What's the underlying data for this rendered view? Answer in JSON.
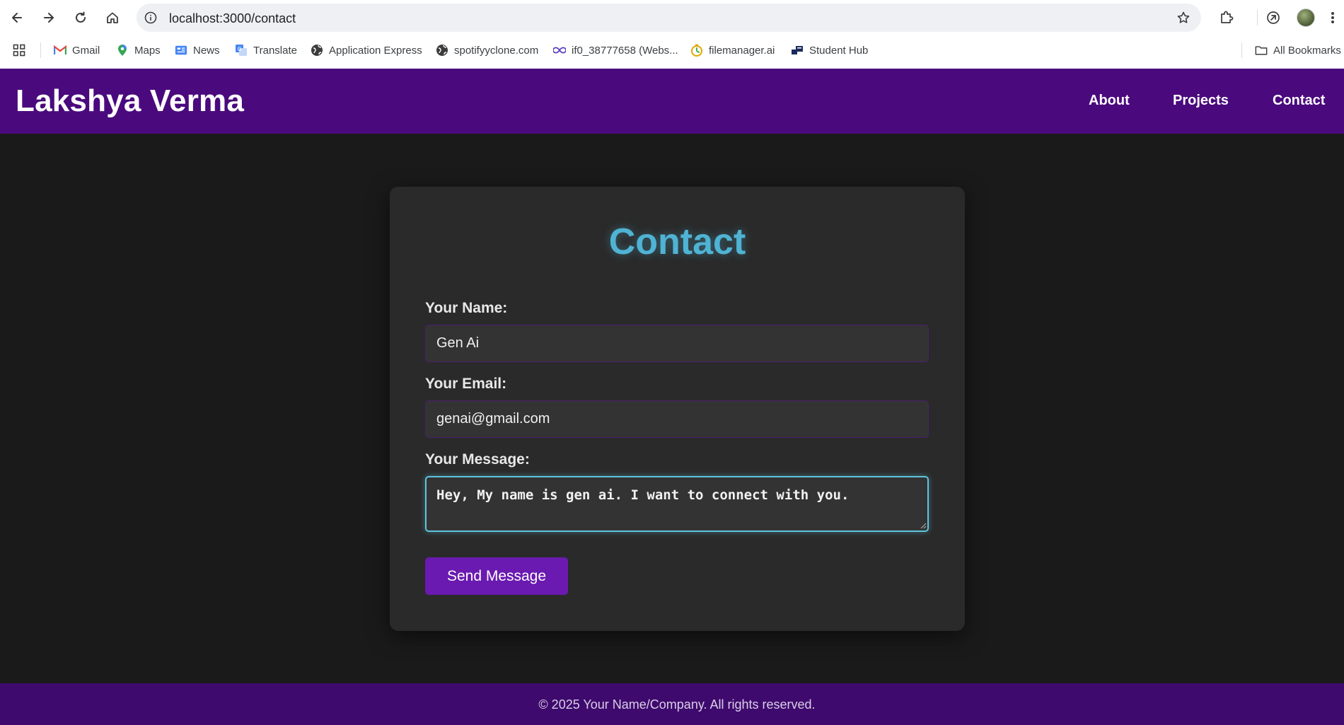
{
  "browser": {
    "url": "localhost:3000/contact",
    "bookmarks": [
      {
        "label": "Gmail",
        "icon": "gmail-icon"
      },
      {
        "label": "Maps",
        "icon": "maps-pin-icon"
      },
      {
        "label": "News",
        "icon": "news-icon"
      },
      {
        "label": "Translate",
        "icon": "translate-icon"
      },
      {
        "label": "Application Express",
        "icon": "globe-icon"
      },
      {
        "label": "spotifyyclone.com",
        "icon": "globe-icon"
      },
      {
        "label": "if0_38777658 (Webs...",
        "icon": "infinity-icon"
      },
      {
        "label": "filemanager.ai",
        "icon": "filemanager-icon"
      },
      {
        "label": "Student Hub",
        "icon": "student-hub-icon"
      }
    ],
    "all_bookmarks": "All Bookmarks"
  },
  "site": {
    "brand": "Lakshya Verma",
    "nav": [
      "About",
      "Projects",
      "Contact"
    ]
  },
  "form": {
    "title": "Contact",
    "name_label": "Your Name:",
    "name_value": "Gen Ai",
    "email_label": "Your Email:",
    "email_value": "genai@gmail.com",
    "message_label": "Your Message:",
    "message_value": "Hey, My name is gen ai. I want to connect with you.",
    "submit_label": "Send Message"
  },
  "footer": {
    "text": "© 2025 Your Name/Company. All rights reserved."
  },
  "colors": {
    "header_bg": "#4a0a7d",
    "footer_bg": "#3f0a6e",
    "accent_title": "#4fb3d4",
    "button_bg": "#6a1ab0",
    "page_bg": "#1a1a1a",
    "card_bg": "#2a2a2a"
  }
}
